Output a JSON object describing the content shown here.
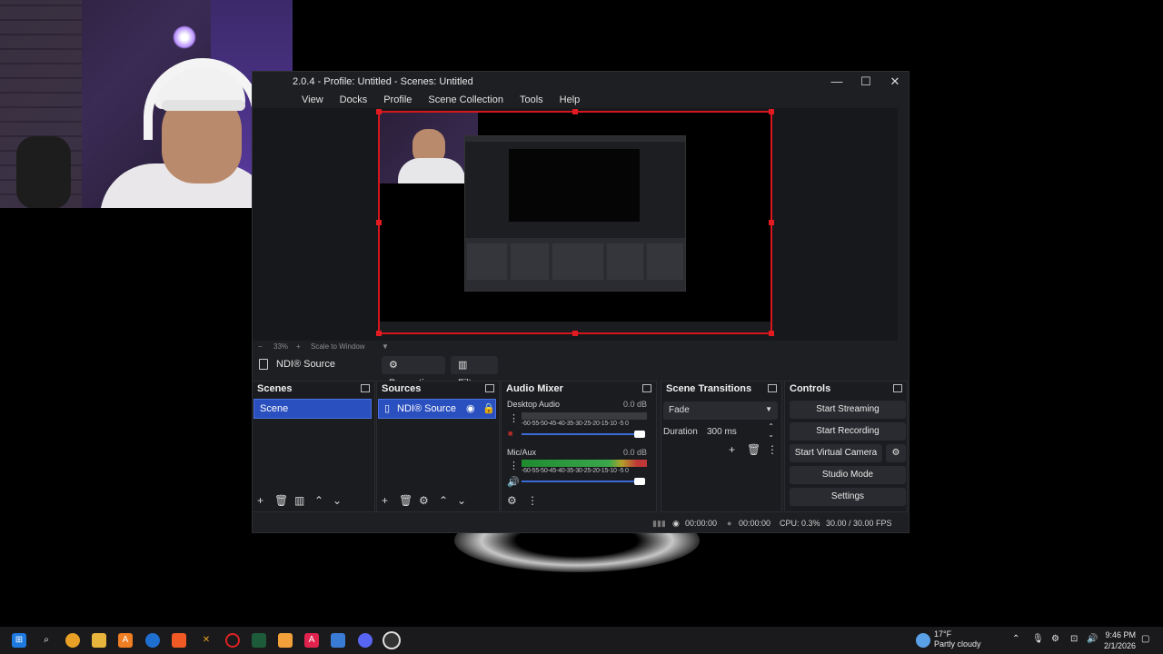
{
  "window": {
    "title": "2.0.4 - Profile: Untitled - Scenes: Untitled",
    "controls": [
      "—",
      "☐",
      "✕"
    ]
  },
  "menu": [
    "View",
    "Docks",
    "Profile",
    "Scene Collection",
    "Tools",
    "Help"
  ],
  "preview": {
    "zoom": "33%",
    "scale_mode": "Scale to Window",
    "minus": "−",
    "plus": "+"
  },
  "source_toolbar": {
    "source_name": "NDI® Source",
    "properties": "Properties",
    "filters": "Filters"
  },
  "scenes": {
    "title": "Scenes",
    "items": [
      "Scene"
    ]
  },
  "sources": {
    "title": "Sources",
    "items": [
      "NDI® Source"
    ]
  },
  "audio_mixer": {
    "title": "Audio Mixer",
    "channels": [
      {
        "name": "Desktop Audio",
        "db": "0.0 dB",
        "ticks": "-60-55-50-45-40-35-30-25-20-15-10 -5 0",
        "level": 0.0
      },
      {
        "name": "Mic/Aux",
        "db": "0.0 dB",
        "ticks": "-60-55-50-45-40-35-30-25-20-15-10 -5 0",
        "level": 0.75
      }
    ]
  },
  "scene_transitions": {
    "title": "Scene Transitions",
    "transition": "Fade",
    "duration_label": "Duration",
    "duration_value": "300 ms"
  },
  "controls": {
    "title": "Controls",
    "start_streaming": "Start Streaming",
    "start_recording": "Start Recording",
    "start_virtual_camera": "Start Virtual Camera",
    "studio_mode": "Studio Mode",
    "settings": "Settings"
  },
  "status": {
    "stream_time": "00:00:00",
    "rec_time": "00:00:00",
    "cpu": "CPU: 0.3%",
    "fps": "30.00 / 30.00 FPS"
  },
  "taskbar": {
    "weather_temp": "17°F",
    "weather_desc": "Partly cloudy",
    "time": "9:46 PM",
    "date": "2/1/2026"
  },
  "colors": {
    "accent": "#2a4fbf",
    "canvas_border": "#d6161e",
    "panel_bg": "#1b1c20"
  }
}
